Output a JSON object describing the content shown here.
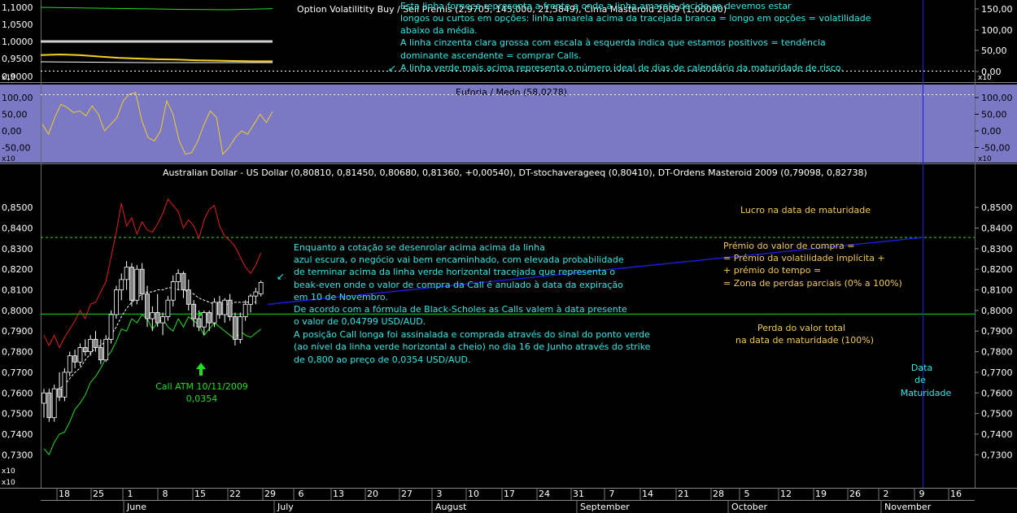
{
  "colors": {
    "background": "#000000",
    "panel_mid": "#7b78c6",
    "text": "#ffffff",
    "cyan": "#33e6e6",
    "orange": "#f2c75a",
    "green": "#22dd22",
    "red": "#e02020",
    "blue": "#1c1ce6",
    "grid": "#555555"
  },
  "top_panel": {
    "title": "Option Volatilitity Buy / Sell Premis (2,9705, 145,000, 21,5849), Cima Masteroid 2009 (1,00000)",
    "left_ticks": [
      "1,1000",
      "1,0500",
      "1,0000",
      "0,9500",
      "0,9000"
    ],
    "right_ticks": [
      "150,00",
      "100,00",
      "50,00",
      "0,00"
    ],
    "scale_mark": "x10",
    "note_lines": [
      "Esta linha fornece representa a frente e onde a linha amarela decide se devemos estar",
      "longos ou curtos em opções: linha amarela acima da tracejada branca = longo em opções = volatilidade",
      "abaixo da média.",
      "A linha cinzenta clara grossa com escala à esquerda indica que estamos positivos = tendência",
      "dominante ascendente = comprar Calls.",
      "A linha verde mais acima representa o número ideal de dias de calendário da maturidade de risco."
    ]
  },
  "mid_panel": {
    "title": "Euforia / Medo (58,0278)",
    "left_ticks": [
      "100,00",
      "50,00",
      "0,00",
      "-50,00"
    ],
    "right_ticks": [
      "100,00",
      "50,00",
      "0,00",
      "-50,00"
    ],
    "scale_mark": "x10"
  },
  "main_panel": {
    "title": "Australian Dollar - US Dollar (0,80810, 0,81450, 0,80680, 0,81360, +0,00540), DT-stochaverageeq (0,80410), DT-Ordens Masteroid 2009 (0,79098, 0,82738)",
    "scale_mark": "x10",
    "annotation_main": [
      "Enquanto a cotação se desenrolar acima acima da linha",
      "azul escura, o negócio vai bem encaminhado, com elevada probabilidade",
      "de terminar acima da linha verde horizontal tracejada que representa o",
      "beak-even onde o valor de compra da Call é anulado à data da expiração",
      "em 10 de Novembro.",
      "De acordo com a fórmula de Black-Scholes as Calls valem à data presente",
      "o valor de 0,04799 USD/AUD.",
      "A posição Call longa foi assinalada e comprada através do sinal do ponto verde",
      "(ao nível da linha verde horizontal a cheio) no dia 16 de Junho através do strike",
      "de 0,800 ao preço de 0,0354 USD/AUD."
    ],
    "lucro": "Lucro na data de maturidade",
    "premio": [
      "Prémio do valor de compra =",
      "= Prémio da volatilidade implícita +",
      "+ prémio do tempo =",
      "= Zona de perdas parciais (0% a 100%)"
    ],
    "perda": [
      "Perda do valor total",
      "na data de maturidade (100%)"
    ],
    "data_maturidade": [
      "Data",
      "de",
      "Maturidade"
    ],
    "call_label": [
      "Call ATM 10/11/2009",
      "0,0354"
    ]
  },
  "x_axis": {
    "days": [
      "18",
      "25",
      "1",
      "8",
      "15",
      "22",
      "29",
      "6",
      "13",
      "20",
      "27",
      "3",
      "10",
      "17",
      "24",
      "31",
      "7",
      "14",
      "21",
      "28",
      "5",
      "12",
      "19",
      "26",
      "2",
      "9",
      "16"
    ],
    "months": [
      "June",
      "July",
      "August",
      "September",
      "October",
      "November"
    ]
  },
  "chart_data": {
    "type": "candlestick",
    "title": "Australian Dollar - US Dollar (0,80810, 0,81450, 0,80680, 0,81360, +0,00540), DT-stochaverageeq (0,80410), DT-Ordens Masteroid 2009 (0,79098, 0,82738)",
    "y_ticks": [
      "0,8500",
      "0,8400",
      "0,8300",
      "0,8200",
      "0,8100",
      "0,8000",
      "0,7900",
      "0,7800",
      "0,7700",
      "0,7600",
      "0,7500",
      "0,7400",
      "0,7300"
    ],
    "ylim": [
      0.725,
      0.8615
    ],
    "breakeven": 0.8354,
    "strike_line": 0.7983,
    "ohlc": [
      [
        0.755,
        0.762,
        0.748,
        0.76
      ],
      [
        0.76,
        0.762,
        0.746,
        0.748
      ],
      [
        0.748,
        0.764,
        0.746,
        0.762
      ],
      [
        0.762,
        0.77,
        0.756,
        0.758
      ],
      [
        0.758,
        0.772,
        0.756,
        0.77
      ],
      [
        0.77,
        0.78,
        0.768,
        0.778
      ],
      [
        0.778,
        0.781,
        0.772,
        0.775
      ],
      [
        0.775,
        0.784,
        0.773,
        0.782
      ],
      [
        0.782,
        0.786,
        0.778,
        0.78
      ],
      [
        0.78,
        0.788,
        0.778,
        0.786
      ],
      [
        0.786,
        0.79,
        0.78,
        0.782
      ],
      [
        0.782,
        0.786,
        0.774,
        0.776
      ],
      [
        0.776,
        0.788,
        0.775,
        0.786
      ],
      [
        0.786,
        0.8,
        0.784,
        0.798
      ],
      [
        0.798,
        0.812,
        0.796,
        0.81
      ],
      [
        0.81,
        0.818,
        0.805,
        0.815
      ],
      [
        0.815,
        0.824,
        0.81,
        0.821
      ],
      [
        0.821,
        0.823,
        0.802,
        0.805
      ],
      [
        0.805,
        0.822,
        0.803,
        0.82
      ],
      [
        0.82,
        0.823,
        0.805,
        0.808
      ],
      [
        0.808,
        0.812,
        0.792,
        0.796
      ],
      [
        0.796,
        0.802,
        0.79,
        0.799
      ],
      [
        0.799,
        0.808,
        0.792,
        0.794
      ],
      [
        0.794,
        0.799,
        0.788,
        0.797
      ],
      [
        0.797,
        0.807,
        0.795,
        0.805
      ],
      [
        0.805,
        0.817,
        0.802,
        0.814
      ],
      [
        0.814,
        0.82,
        0.81,
        0.818
      ],
      [
        0.818,
        0.819,
        0.806,
        0.81
      ],
      [
        0.81,
        0.815,
        0.8,
        0.803
      ],
      [
        0.803,
        0.805,
        0.792,
        0.796
      ],
      [
        0.796,
        0.8,
        0.79,
        0.792
      ],
      [
        0.792,
        0.8,
        0.788,
        0.799
      ],
      [
        0.799,
        0.8,
        0.79,
        0.794
      ],
      [
        0.794,
        0.806,
        0.792,
        0.804
      ],
      [
        0.804,
        0.807,
        0.796,
        0.798
      ],
      [
        0.798,
        0.806,
        0.794,
        0.805
      ],
      [
        0.805,
        0.808,
        0.795,
        0.797
      ],
      [
        0.797,
        0.799,
        0.783,
        0.786
      ],
      [
        0.786,
        0.799,
        0.784,
        0.797
      ],
      [
        0.797,
        0.805,
        0.795,
        0.803
      ],
      [
        0.803,
        0.808,
        0.799,
        0.807
      ],
      [
        0.807,
        0.811,
        0.803,
        0.809
      ],
      [
        0.8081,
        0.8145,
        0.8068,
        0.8136
      ]
    ],
    "upper_band": [
      0.788,
      0.783,
      0.788,
      0.782,
      0.787,
      0.791,
      0.795,
      0.8,
      0.796,
      0.803,
      0.804,
      0.809,
      0.814,
      0.826,
      0.838,
      0.852,
      0.841,
      0.845,
      0.837,
      0.843,
      0.839,
      0.838,
      0.842,
      0.847,
      0.854,
      0.851,
      0.848,
      0.84,
      0.844,
      0.841,
      0.835,
      0.844,
      0.849,
      0.851,
      0.841,
      0.836,
      0.834,
      0.831,
      0.826,
      0.821,
      0.818,
      0.822,
      0.828
    ],
    "lower_band": [
      0.733,
      0.73,
      0.736,
      0.74,
      0.741,
      0.746,
      0.752,
      0.755,
      0.759,
      0.765,
      0.768,
      0.772,
      0.777,
      0.78,
      0.785,
      0.791,
      0.79,
      0.796,
      0.794,
      0.798,
      0.796,
      0.791,
      0.794,
      0.796,
      0.792,
      0.79,
      0.796,
      0.792,
      0.797,
      0.795,
      0.793,
      0.788,
      0.791,
      0.794,
      0.792,
      0.79,
      0.788,
      0.786,
      0.79,
      0.788,
      0.787,
      0.789,
      0.791
    ],
    "stoch_avg": [
      0.758,
      0.756,
      0.76,
      0.762,
      0.764,
      0.767,
      0.77,
      0.772,
      0.776,
      0.779,
      0.782,
      0.783,
      0.785,
      0.788,
      0.792,
      0.797,
      0.801,
      0.804,
      0.806,
      0.808,
      0.809,
      0.809,
      0.81,
      0.81,
      0.811,
      0.811,
      0.81,
      0.81,
      0.809,
      0.808,
      0.806,
      0.805,
      0.804,
      0.803,
      0.803,
      0.803,
      0.803,
      0.804,
      0.804,
      0.804,
      0.804,
      0.8041
    ],
    "blue_line": [
      [
        0.803,
        0.8354
      ]
    ],
    "euforia_medo": [
      20,
      -10,
      40,
      80,
      70,
      55,
      60,
      45,
      75,
      50,
      0,
      20,
      40,
      90,
      110,
      115,
      30,
      -20,
      -30,
      0,
      90,
      50,
      -30,
      -70,
      -65,
      -30,
      20,
      60,
      40,
      -70,
      -50,
      -20,
      0,
      -10,
      20,
      50,
      25,
      58
    ],
    "vol_yellow": [
      0.96,
      0.962,
      0.96,
      0.956,
      0.952,
      0.95,
      0.948,
      0.947,
      0.945,
      0.944,
      0.943,
      0.942,
      0.942
    ],
    "vol_gray": [
      1.0,
      1.0
    ],
    "vol_green": [
      1.1,
      1.098,
      1.096,
      1.094,
      1.093,
      1.096
    ]
  }
}
